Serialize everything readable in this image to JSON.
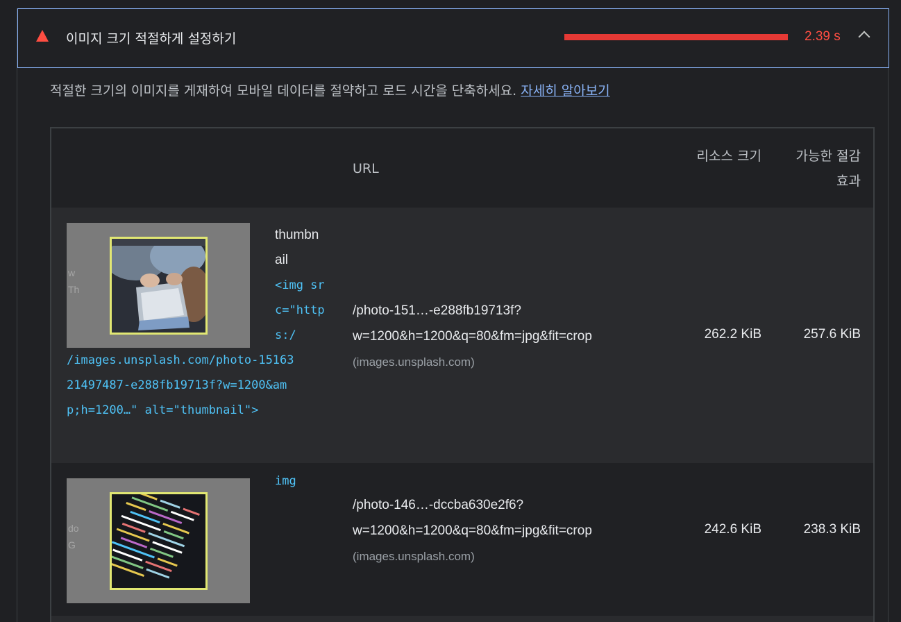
{
  "audit": {
    "title": "이미지 크기 적절하게 설정하기",
    "metric_value": "2.39 s",
    "status_color": "#ff4e42",
    "icon": "fail-triangle-icon",
    "expand_icon": "chevron-up-icon"
  },
  "description": {
    "text": "적절한 크기의 이미지를 게재하여 모바일 데이터를 절약하고 로드 시간을 단축하세요. ",
    "link_label": "자세히 알아보기"
  },
  "table": {
    "headers": {
      "url": "URL",
      "resource_size": "리소스 크기",
      "potential_savings": "가능한 절감 효과"
    },
    "rows": [
      {
        "thumb_alt": "w\nTh",
        "node_label": "thumbnail",
        "snippet_narrow": "<img src=\"https:/",
        "snippet_wide": "/images.unsplash.com/photo-1516321497487-e288fb19713f?w=1200&amp;h=1200…\" alt=\"thumbnail\">",
        "url_path": "/photo-151…-e288fb19713f?w=1200&h=1200&q=80&fm=jpg&fit=crop",
        "url_origin": "(images.unsplash.com)",
        "resource_size": "262.2 KiB",
        "savings": "257.6 KiB"
      },
      {
        "thumb_alt": "do\nG",
        "node_label": "img",
        "url_path": "/photo-146…-dccba630e2f6?w=1200&h=1200&q=80&fm=jpg&fit=crop",
        "url_origin": "(images.unsplash.com)",
        "resource_size": "242.6 KiB",
        "savings": "238.3 KiB"
      }
    ]
  }
}
